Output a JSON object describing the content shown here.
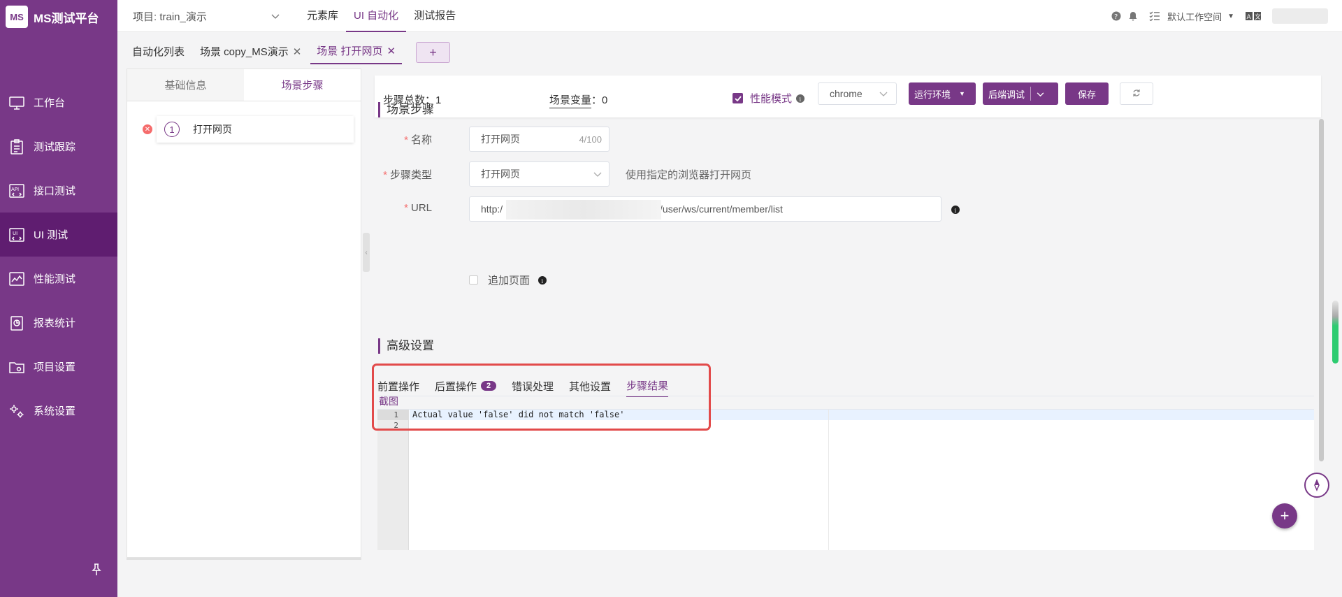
{
  "app": {
    "logo_mark": "MS",
    "name": "MS测试平台"
  },
  "sidebar": {
    "items": [
      {
        "label": "工作台",
        "icon": "monitor-icon"
      },
      {
        "label": "测试跟踪",
        "icon": "clipboard-icon"
      },
      {
        "label": "接口测试",
        "icon": "api-icon"
      },
      {
        "label": "UI 测试",
        "icon": "ui-icon"
      },
      {
        "label": "性能测试",
        "icon": "chart-icon"
      },
      {
        "label": "报表统计",
        "icon": "report-icon"
      },
      {
        "label": "项目设置",
        "icon": "folder-settings-icon"
      },
      {
        "label": "系统设置",
        "icon": "gear-icon"
      }
    ],
    "active_index": 3
  },
  "topbar": {
    "project": "项目: train_演示",
    "menu": [
      "元素库",
      "UI 自动化",
      "测试报告"
    ],
    "active_menu": 1,
    "workspace": "默认工作空间"
  },
  "tabs": {
    "items": [
      {
        "label": "自动化列表",
        "closable": false
      },
      {
        "label": "场景 copy_MS演示",
        "closable": true
      },
      {
        "label": "场景 打开网页",
        "closable": true
      }
    ],
    "add_label": "+"
  },
  "left_panel": {
    "tabs": [
      "基础信息",
      "场景步骤"
    ],
    "active_tab": 1,
    "steps": [
      {
        "index": "1",
        "name": "打开网页"
      }
    ]
  },
  "toolbar": {
    "steps_total_label": "步骤总数：",
    "steps_total": "1",
    "scene_var_label": "场景变量",
    "scene_var_value": "：0",
    "perf_mode": "性能模式",
    "browser": "chrome",
    "run_env": "运行环境",
    "backend_debug": "后端调试",
    "save": "保存"
  },
  "scene_steps": {
    "title": "场景步骤",
    "name_label": "名称",
    "name_value": "打开网页",
    "name_counter": "4/100",
    "type_label": "步骤类型",
    "type_value": "打开网页",
    "type_hint": "使用指定的浏览器打开网页",
    "url_label": "URL",
    "url_prefix": "http:/",
    "url_suffix": "pi/user/ws/current/member/list",
    "append_page": "追加页面"
  },
  "advanced": {
    "title": "高级设置",
    "tabs": [
      "前置操作",
      "后置操作",
      "错误处理",
      "其他设置",
      "步骤结果"
    ],
    "post_badge": "2",
    "active_tab": 4,
    "screenshot_link": "截图",
    "code_lines": [
      "Actual value 'false' did not match 'false'",
      ""
    ],
    "line_numbers": [
      "1",
      "2"
    ]
  },
  "colors": {
    "brand": "#783887",
    "danger": "#e24a4a",
    "active_nav": "#5f1d70"
  }
}
